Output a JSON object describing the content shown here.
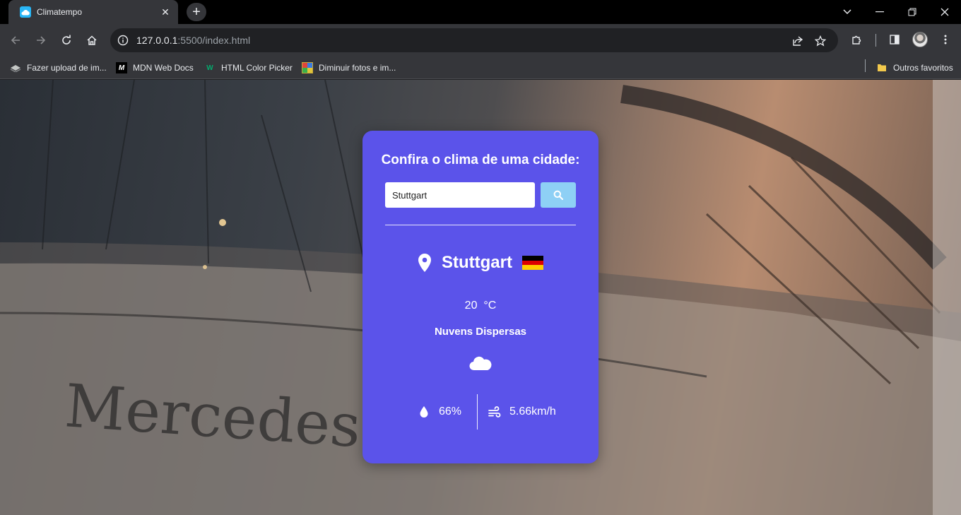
{
  "browser": {
    "tab_title": "Climatempo",
    "url_host": "127.0.0.1",
    "url_rest": ":5500/index.html"
  },
  "bookmarks": [
    {
      "label": "Fazer upload de im..."
    },
    {
      "label": "MDN Web Docs"
    },
    {
      "label": "HTML Color Picker"
    },
    {
      "label": "Diminuir fotos e im..."
    }
  ],
  "other_bookmarks": "Outros favoritos",
  "weather": {
    "heading": "Confira o clima de uma cidade:",
    "search_value": "Stuttgart",
    "city": "Stuttgart",
    "temperature": "20",
    "unit": "°C",
    "description": "Nuvens Dispersas",
    "humidity": "66%",
    "wind": "5.66km/h",
    "card_color": "#5b53ea",
    "button_color": "#8ed0f5"
  }
}
